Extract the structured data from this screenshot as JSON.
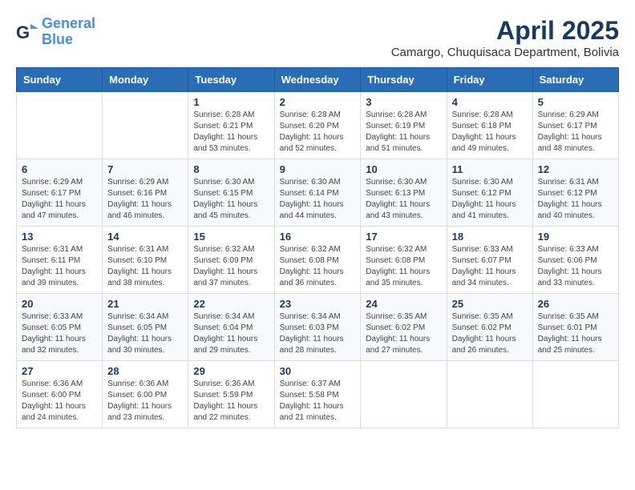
{
  "header": {
    "logo_line1": "General",
    "logo_line2": "Blue",
    "month_title": "April 2025",
    "location": "Camargo, Chuquisaca Department, Bolivia"
  },
  "days_of_week": [
    "Sunday",
    "Monday",
    "Tuesday",
    "Wednesday",
    "Thursday",
    "Friday",
    "Saturday"
  ],
  "weeks": [
    [
      {
        "day": "",
        "text": ""
      },
      {
        "day": "",
        "text": ""
      },
      {
        "day": "1",
        "text": "Sunrise: 6:28 AM\nSunset: 6:21 PM\nDaylight: 11 hours and 53 minutes."
      },
      {
        "day": "2",
        "text": "Sunrise: 6:28 AM\nSunset: 6:20 PM\nDaylight: 11 hours and 52 minutes."
      },
      {
        "day": "3",
        "text": "Sunrise: 6:28 AM\nSunset: 6:19 PM\nDaylight: 11 hours and 51 minutes."
      },
      {
        "day": "4",
        "text": "Sunrise: 6:28 AM\nSunset: 6:18 PM\nDaylight: 11 hours and 49 minutes."
      },
      {
        "day": "5",
        "text": "Sunrise: 6:29 AM\nSunset: 6:17 PM\nDaylight: 11 hours and 48 minutes."
      }
    ],
    [
      {
        "day": "6",
        "text": "Sunrise: 6:29 AM\nSunset: 6:17 PM\nDaylight: 11 hours and 47 minutes."
      },
      {
        "day": "7",
        "text": "Sunrise: 6:29 AM\nSunset: 6:16 PM\nDaylight: 11 hours and 46 minutes."
      },
      {
        "day": "8",
        "text": "Sunrise: 6:30 AM\nSunset: 6:15 PM\nDaylight: 11 hours and 45 minutes."
      },
      {
        "day": "9",
        "text": "Sunrise: 6:30 AM\nSunset: 6:14 PM\nDaylight: 11 hours and 44 minutes."
      },
      {
        "day": "10",
        "text": "Sunrise: 6:30 AM\nSunset: 6:13 PM\nDaylight: 11 hours and 43 minutes."
      },
      {
        "day": "11",
        "text": "Sunrise: 6:30 AM\nSunset: 6:12 PM\nDaylight: 11 hours and 41 minutes."
      },
      {
        "day": "12",
        "text": "Sunrise: 6:31 AM\nSunset: 6:12 PM\nDaylight: 11 hours and 40 minutes."
      }
    ],
    [
      {
        "day": "13",
        "text": "Sunrise: 6:31 AM\nSunset: 6:11 PM\nDaylight: 11 hours and 39 minutes."
      },
      {
        "day": "14",
        "text": "Sunrise: 6:31 AM\nSunset: 6:10 PM\nDaylight: 11 hours and 38 minutes."
      },
      {
        "day": "15",
        "text": "Sunrise: 6:32 AM\nSunset: 6:09 PM\nDaylight: 11 hours and 37 minutes."
      },
      {
        "day": "16",
        "text": "Sunrise: 6:32 AM\nSunset: 6:08 PM\nDaylight: 11 hours and 36 minutes."
      },
      {
        "day": "17",
        "text": "Sunrise: 6:32 AM\nSunset: 6:08 PM\nDaylight: 11 hours and 35 minutes."
      },
      {
        "day": "18",
        "text": "Sunrise: 6:33 AM\nSunset: 6:07 PM\nDaylight: 11 hours and 34 minutes."
      },
      {
        "day": "19",
        "text": "Sunrise: 6:33 AM\nSunset: 6:06 PM\nDaylight: 11 hours and 33 minutes."
      }
    ],
    [
      {
        "day": "20",
        "text": "Sunrise: 6:33 AM\nSunset: 6:05 PM\nDaylight: 11 hours and 32 minutes."
      },
      {
        "day": "21",
        "text": "Sunrise: 6:34 AM\nSunset: 6:05 PM\nDaylight: 11 hours and 30 minutes."
      },
      {
        "day": "22",
        "text": "Sunrise: 6:34 AM\nSunset: 6:04 PM\nDaylight: 11 hours and 29 minutes."
      },
      {
        "day": "23",
        "text": "Sunrise: 6:34 AM\nSunset: 6:03 PM\nDaylight: 11 hours and 28 minutes."
      },
      {
        "day": "24",
        "text": "Sunrise: 6:35 AM\nSunset: 6:02 PM\nDaylight: 11 hours and 27 minutes."
      },
      {
        "day": "25",
        "text": "Sunrise: 6:35 AM\nSunset: 6:02 PM\nDaylight: 11 hours and 26 minutes."
      },
      {
        "day": "26",
        "text": "Sunrise: 6:35 AM\nSunset: 6:01 PM\nDaylight: 11 hours and 25 minutes."
      }
    ],
    [
      {
        "day": "27",
        "text": "Sunrise: 6:36 AM\nSunset: 6:00 PM\nDaylight: 11 hours and 24 minutes."
      },
      {
        "day": "28",
        "text": "Sunrise: 6:36 AM\nSunset: 6:00 PM\nDaylight: 11 hours and 23 minutes."
      },
      {
        "day": "29",
        "text": "Sunrise: 6:36 AM\nSunset: 5:59 PM\nDaylight: 11 hours and 22 minutes."
      },
      {
        "day": "30",
        "text": "Sunrise: 6:37 AM\nSunset: 5:58 PM\nDaylight: 11 hours and 21 minutes."
      },
      {
        "day": "",
        "text": ""
      },
      {
        "day": "",
        "text": ""
      },
      {
        "day": "",
        "text": ""
      }
    ]
  ]
}
